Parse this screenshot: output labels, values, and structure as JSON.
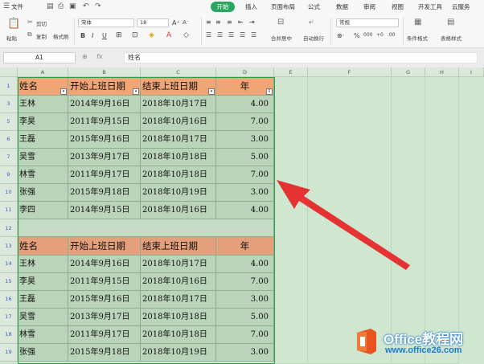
{
  "menubar": {
    "file_label": "文件",
    "tabs": [
      {
        "label": "开始",
        "active": true
      },
      {
        "label": "插入"
      },
      {
        "label": "页面布局"
      },
      {
        "label": "公式"
      },
      {
        "label": "数据"
      },
      {
        "label": "审阅"
      },
      {
        "label": "视图"
      },
      {
        "label": "开发工具"
      },
      {
        "label": "云服务"
      }
    ]
  },
  "ribbon": {
    "paste_label": "粘贴",
    "cut_label": "剪切",
    "copy_label": "复制",
    "format_painter_label": "格式刷",
    "font_name": "宋体",
    "font_size": "18",
    "bold": "B",
    "italic": "I",
    "underline": "U",
    "merge_label": "合并居中",
    "wrap_label": "自动换行",
    "number_format": "常规",
    "percent_symbol": "%",
    "thousands_symbol": "000",
    "cond_format_label": "条件格式",
    "table_style_label": "表格样式"
  },
  "formula_bar": {
    "name_box": "A1",
    "fx_label": "fx",
    "content": "姓名"
  },
  "columns": [
    "A",
    "B",
    "C",
    "D",
    "E",
    "F",
    "G",
    "H",
    "I"
  ],
  "table1": {
    "headers": [
      "姓名",
      "开始上班日期",
      "结束上班日期",
      "年"
    ],
    "rows": [
      {
        "row": "3",
        "name": "王林",
        "start": "2014年9月16日",
        "end": "2018年10月17日",
        "years": "4.00"
      },
      {
        "row": "5",
        "name": "李昊",
        "start": "2011年9月15日",
        "end": "2018年10月16日",
        "years": "7.00"
      },
      {
        "row": "6",
        "name": "王磊",
        "start": "2015年9月16日",
        "end": "2018年10月17日",
        "years": "3.00"
      },
      {
        "row": "7",
        "name": "吴雪",
        "start": "2013年9月17日",
        "end": "2018年10月18日",
        "years": "5.00"
      },
      {
        "row": "9",
        "name": "林雪",
        "start": "2011年9月17日",
        "end": "2018年10月18日",
        "years": "7.00"
      },
      {
        "row": "10",
        "name": "张强",
        "start": "2015年9月18日",
        "end": "2018年10月19日",
        "years": "3.00"
      },
      {
        "row": "11",
        "name": "李四",
        "start": "2014年9月15日",
        "end": "2018年10月16日",
        "years": "4.00"
      }
    ]
  },
  "row_numbers": {
    "header1": "1",
    "blank": "12",
    "header2": "13"
  },
  "table2": {
    "headers": [
      "姓名",
      "开始上班日期",
      "结束上班日期",
      "年"
    ],
    "rows": [
      {
        "row": "14",
        "name": "王林",
        "start": "2014年9月16日",
        "end": "2018年10月17日",
        "years": "4.00"
      },
      {
        "row": "15",
        "name": "李昊",
        "start": "2011年9月15日",
        "end": "2018年10月16日",
        "years": "7.00"
      },
      {
        "row": "16",
        "name": "王磊",
        "start": "2015年9月16日",
        "end": "2018年10月17日",
        "years": "3.00"
      },
      {
        "row": "17",
        "name": "吴雪",
        "start": "2013年9月17日",
        "end": "2018年10月18日",
        "years": "5.00"
      },
      {
        "row": "18",
        "name": "林雪",
        "start": "2011年9月17日",
        "end": "2018年10月18日",
        "years": "7.00"
      },
      {
        "row": "19",
        "name": "张强",
        "start": "2015年9月18日",
        "end": "2018年10月19日",
        "years": "3.00"
      }
    ]
  },
  "watermark": {
    "brand": "Office教程网",
    "url": "www.office26.com"
  },
  "colors": {
    "active_tab": "#2aa660",
    "header_fill": "#f0a577",
    "row_fill": "#b9d4b9",
    "sheet_bg": "#cfe6cf",
    "arrow": "#e53333",
    "logo_orange": "#e8541e",
    "logo_blue": "#1f7bd1"
  },
  "icons": [
    "menu-icon",
    "save-icon",
    "print-icon",
    "undo-icon",
    "redo-icon",
    "paste-icon",
    "cut-icon",
    "copy-icon",
    "format-painter-icon",
    "filter-icon",
    "arrow-annotation",
    "office-logo-icon"
  ]
}
